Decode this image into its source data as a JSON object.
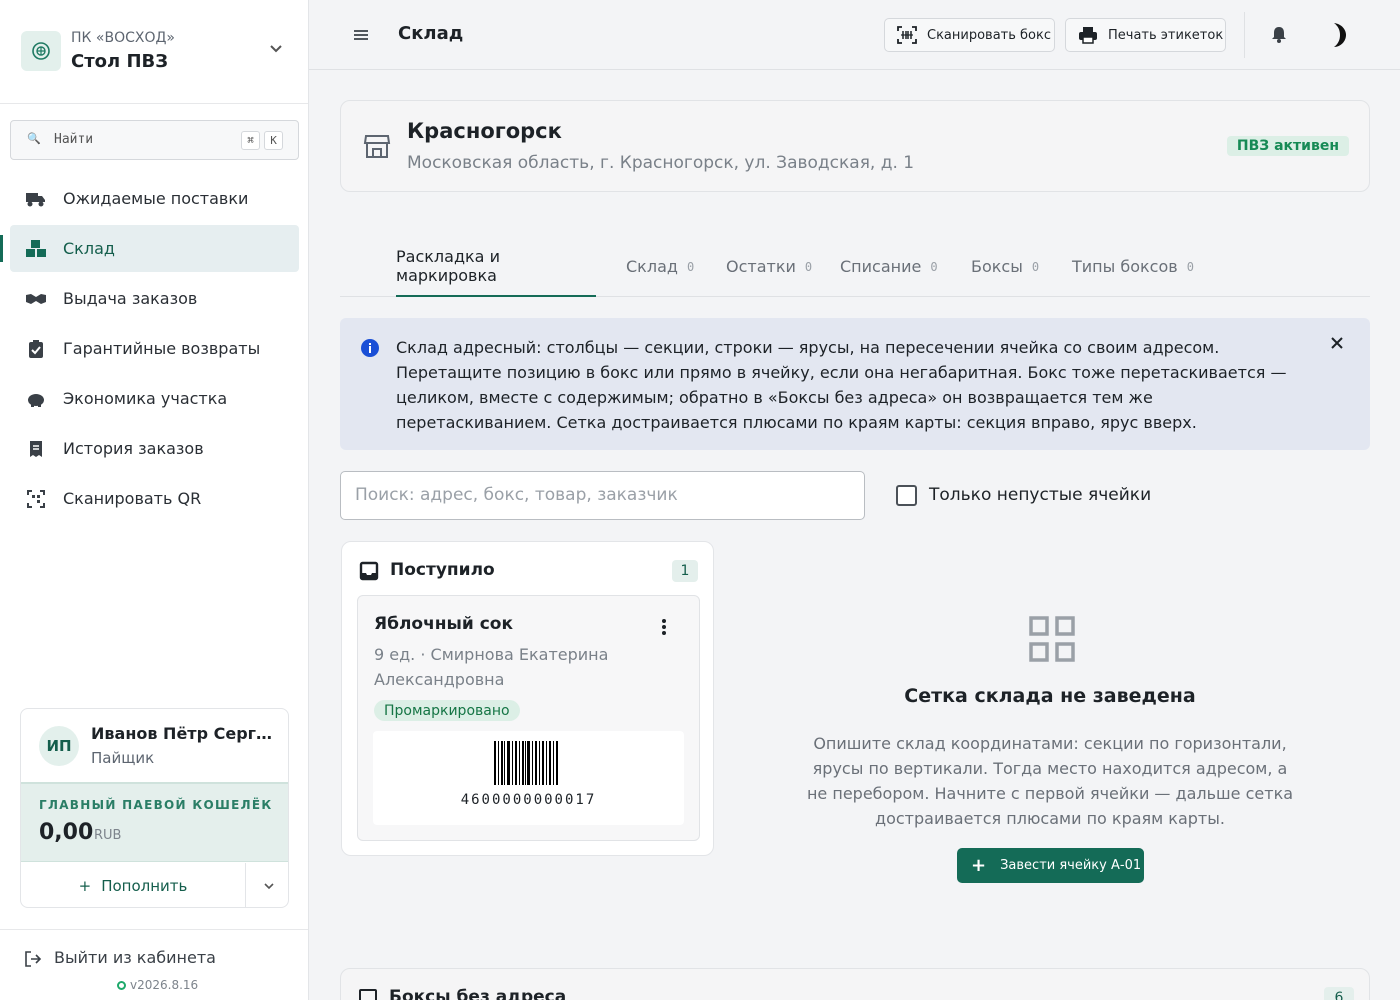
{
  "org": {
    "name": "ПК «ВОСХОД»",
    "title": "Стол ПВЗ"
  },
  "search": {
    "placeholder": "Найти",
    "kbd1": "⌘",
    "kbd2": "K"
  },
  "sidebar": {
    "items": [
      {
        "label": "Ожидаемые поставки",
        "icon": "truck-icon"
      },
      {
        "label": "Склад",
        "icon": "warehouse-icon"
      },
      {
        "label": "Выдача заказов",
        "icon": "handshake-icon"
      },
      {
        "label": "Гарантийные возвраты",
        "icon": "clipboard-check-icon"
      },
      {
        "label": "Экономика участка",
        "icon": "piggy-bank-icon"
      },
      {
        "label": "История заказов",
        "icon": "receipt-icon"
      },
      {
        "label": "Сканировать QR",
        "icon": "qr-scan-icon"
      }
    ],
    "active_index": 1
  },
  "user": {
    "initials": "ИП",
    "name": "Иванов Пётр Сергеевич",
    "role": "Пайщик",
    "wallet_label": "ГЛАВНЫЙ ПАЕВОЙ КОШЕЛЁК",
    "wallet_amount": "0,00",
    "wallet_currency": "RUB",
    "topup_label": "Пополнить"
  },
  "logout": {
    "label": "Выйти из кабинета",
    "version": "v2026.8.16"
  },
  "topbar": {
    "title": "Склад",
    "scan_box_label": "Сканировать бокс",
    "print_labels_label": "Печать этикеток"
  },
  "location": {
    "title": "Красногорск",
    "address": "Московская область, г. Красногорск, ул. Заводская, д. 1",
    "status": "ПВЗ активен"
  },
  "tabs": [
    {
      "label": "Раскладка и маркировка",
      "count": ""
    },
    {
      "label": "Склад",
      "count": "0"
    },
    {
      "label": "Остатки",
      "count": "0"
    },
    {
      "label": "Списание",
      "count": "0"
    },
    {
      "label": "Боксы",
      "count": "0"
    },
    {
      "label": "Типы боксов",
      "count": "0"
    }
  ],
  "info": {
    "text": "Склад адресный: столбцы — секции, строки — ярусы, на пересечении ячейка со своим адресом. Перетащите позицию в бокс или прямо в ячейку, если она негабаритная. Бокс тоже перетаскивается — целиком, вместе с содержимым; обратно в «Боксы без адреса» он возвращается тем же перетаскиванием. Сетка достраивается плюсами по краям карты: секция вправо, ярус вверх."
  },
  "filter": {
    "placeholder": "Поиск: адрес, бокс, товар, заказчик",
    "nonempty_label": "Только непустые ячейки",
    "nonempty_checked": false
  },
  "incoming": {
    "title": "Поступило",
    "count": "1",
    "item": {
      "name": "Яблочный сок",
      "meta": "9 ед. · Смирнова Екатерина Александровна",
      "status": "Промаркировано",
      "barcode": "4600000000017"
    }
  },
  "empty_grid": {
    "title": "Сетка склада не заведена",
    "text": "Опишите склад координатами: секции по горизонтали, ярусы по вертикали. Тогда место находится адресом, а не перебором. Начните с первой ячейки — дальше сетка достраивается плюсами по краям карты.",
    "cta_label": "Завести ячейку А-01"
  },
  "boxes_no_address": {
    "title": "Боксы без адреса",
    "count": "6"
  },
  "colors": {
    "accent": "#146b57",
    "accent_light": "#e4efec",
    "success": "#168a55",
    "info_bg": "#e3e7f1"
  }
}
